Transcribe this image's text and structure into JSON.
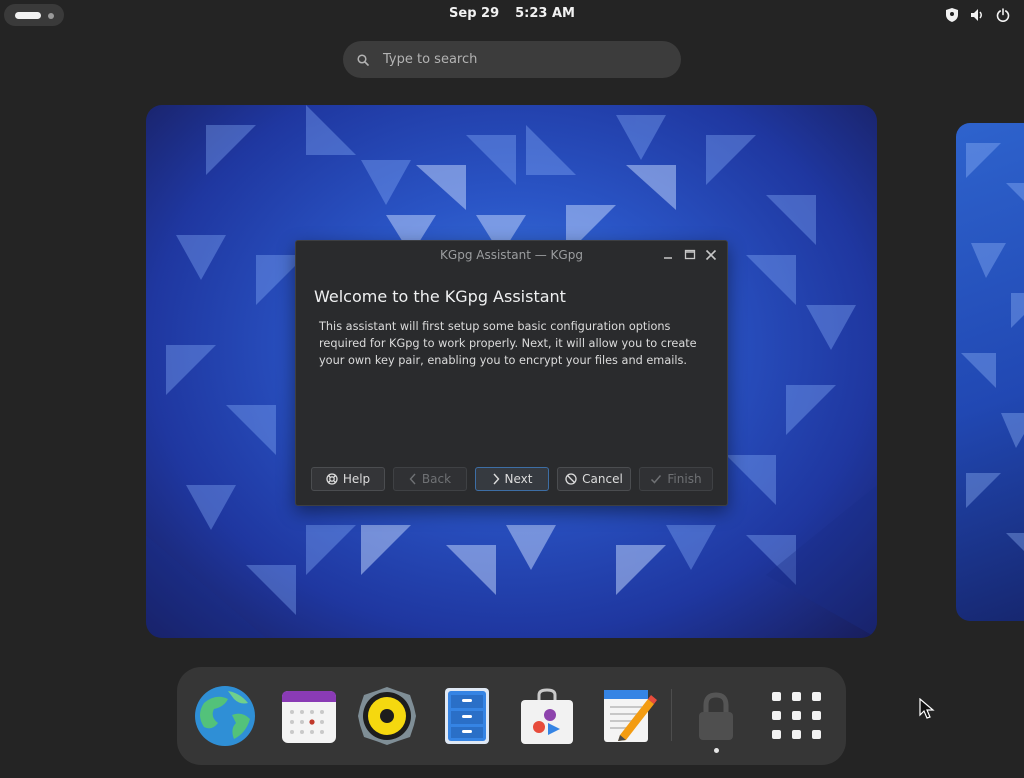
{
  "topbar": {
    "date": "Sep 29",
    "time": "5:23 AM",
    "tray_icons": [
      "shield-icon",
      "speaker-icon",
      "power-icon"
    ]
  },
  "search": {
    "placeholder": "Type to search",
    "icon": "search-icon"
  },
  "dialog": {
    "window_title": "KGpg Assistant — KGpg",
    "heading": "Welcome to the KGpg Assistant",
    "body": "This assistant will first setup some basic configuration options\nrequired for KGpg to work properly. Next, it will allow you to create\nyour own key pair, enabling you to encrypt your files and emails.",
    "buttons": {
      "help": "Help",
      "back": "Back",
      "next": "Next",
      "cancel": "Cancel",
      "finish": "Finish"
    }
  },
  "dock": {
    "apps": [
      "web-browser-icon",
      "calendar-icon",
      "music-player-icon",
      "file-manager-icon",
      "software-store-icon",
      "text-editor-icon",
      "kgpg-lock-icon",
      "app-grid-icon"
    ]
  },
  "colors": {
    "background": "#242424",
    "dialog": "#2a2b2d",
    "dock": "#363636",
    "focus": "#3d6ea5"
  }
}
